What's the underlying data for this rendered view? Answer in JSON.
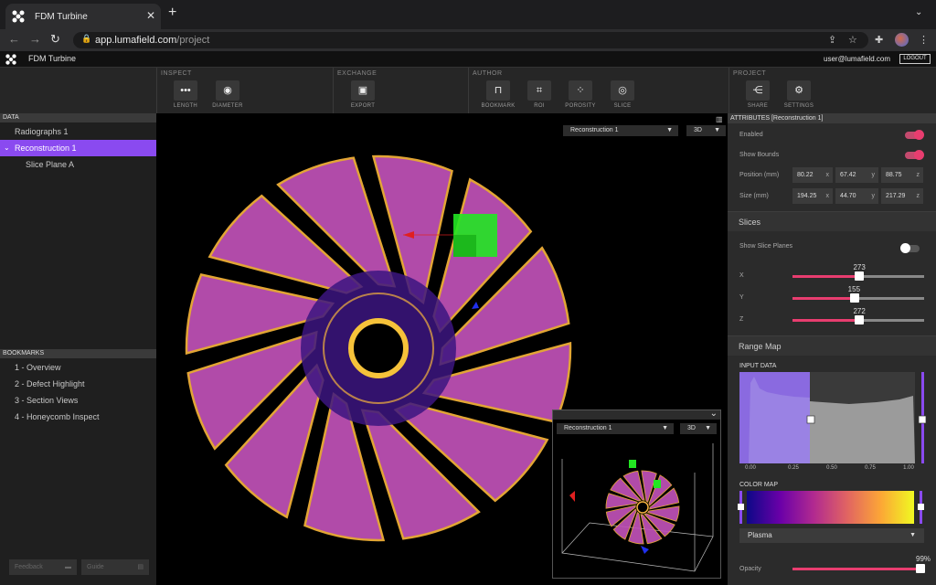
{
  "browser": {
    "tab_title": "FDM Turbine",
    "url_host": "app.lumafield.com",
    "url_path": "/project"
  },
  "app": {
    "name": "FDM Turbine",
    "user": "user@lumafield.com",
    "logout_label": "LOGOUT"
  },
  "toolbar": {
    "sections": [
      "INSPECT",
      "EXCHANGE",
      "AUTHOR",
      "PROJECT"
    ],
    "inspect": [
      "LENGTH",
      "DIAMETER"
    ],
    "exchange": [
      "EXPORT"
    ],
    "author": [
      "BOOKMARK",
      "ROI",
      "POROSITY",
      "SLICE"
    ],
    "project": [
      "SHARE",
      "SETTINGS"
    ]
  },
  "data_panel": {
    "title": "DATA",
    "items": [
      "Radiographs 1",
      "Reconstruction 1",
      "Slice Plane A"
    ]
  },
  "bookmarks": {
    "title": "BOOKMARKS",
    "items": [
      "1 - Overview",
      "2 - Defect Highlight",
      "3 - Section Views",
      "4 - Honeycomb Inspect"
    ]
  },
  "footer": {
    "feedback": "Feedback",
    "guide": "Guide"
  },
  "viewport": {
    "object_select": "Reconstruction 1",
    "view_mode": "3D",
    "inset_object_select": "Reconstruction 1",
    "inset_view_mode": "3D"
  },
  "attributes": {
    "title": "ATTRIBUTES [Reconstruction 1]",
    "enabled_label": "Enabled",
    "enabled": true,
    "show_bounds_label": "Show Bounds",
    "show_bounds": true,
    "position_label": "Position (mm)",
    "position": [
      "80.22",
      "67.42",
      "88.75"
    ],
    "size_label": "Size (mm)",
    "size": [
      "194.25",
      "44.70",
      "217.29"
    ],
    "axes": [
      "x",
      "y",
      "z"
    ]
  },
  "slices": {
    "title": "Slices",
    "show_planes_label": "Show Slice Planes",
    "show_planes": false,
    "axes": [
      "X",
      "Y",
      "Z"
    ],
    "values": [
      "273",
      "155",
      "272"
    ],
    "fractions": [
      0.51,
      0.47,
      0.51
    ]
  },
  "range_map": {
    "title": "Range Map",
    "input_label": "INPUT DATA",
    "ticks": [
      "0.00",
      "0.25",
      "0.50",
      "0.75",
      "1.00"
    ],
    "color_map_label": "COLOR MAP",
    "colormap": "Plasma",
    "opacity_label": "Opacity",
    "opacity": "99%",
    "opacity_fraction": 0.99
  },
  "colors": {
    "accent": "#e83d6f",
    "selection": "#8a4af0"
  }
}
